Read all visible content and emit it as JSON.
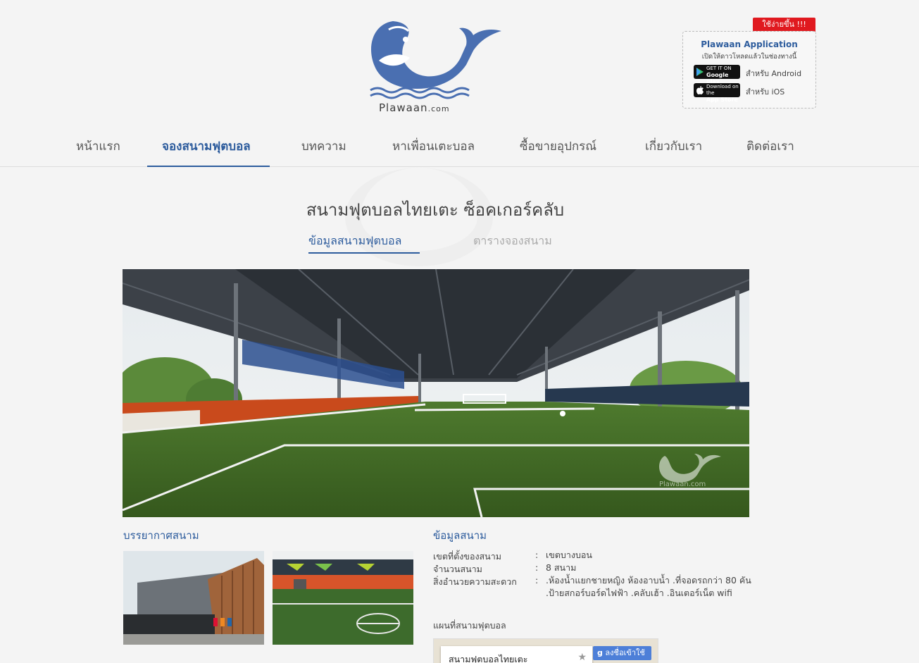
{
  "brand": {
    "logo_text": "Plawaan",
    "logo_domain": ".com",
    "color_primary": "#2d5c9d",
    "color_logo": "#4a6fb1"
  },
  "app_promo": {
    "ribbon": "ใช้ง่ายขึ้น !!!",
    "title": "Plawaan Application",
    "subtitle": "เปิดให้ดาวโหลดแล้วในช่องทางนี้",
    "stores": [
      {
        "badge_small": "GET IT ON",
        "badge_big": "Google play",
        "label": "สำหรับ Android",
        "icon": "google-play-icon"
      },
      {
        "badge_small": "Download on the",
        "badge_big": "App Store",
        "label": "สำหรับ iOS",
        "icon": "apple-icon"
      }
    ]
  },
  "nav": {
    "items": [
      {
        "label": "หน้าแรก"
      },
      {
        "label": "จองสนามฟุตบอล"
      },
      {
        "label": "บทความ"
      },
      {
        "label": "หาเพื่อนเตะบอล"
      },
      {
        "label": "ซื้อขายอุปกรณ์"
      },
      {
        "label": "เกี่ยวกับเรา"
      },
      {
        "label": "ติดต่อเรา"
      }
    ],
    "active_index": 1
  },
  "page": {
    "title": "สนามฟุตบอลไทยเตะ ซ็อคเกอร์คลับ",
    "tabs": [
      {
        "label": "ข้อมูลสนามฟุตบอล",
        "active": true
      },
      {
        "label": "ตารางจองสนาม",
        "active": false
      }
    ],
    "hero_watermark": "Plawaan.com"
  },
  "atmosphere": {
    "title": "บรรยากาศสนาม"
  },
  "field_info": {
    "title": "ข้อมูลสนาม",
    "rows": [
      {
        "label": "เขตที่ตั้งของสนาม",
        "value": "เขตบางบอน"
      },
      {
        "label": "จำนวนสนาม",
        "value": "8 สนาม"
      },
      {
        "label": "สิ่งอำนวยความสะดวก",
        "value": ".ห้องน้ำแยกชายหญิง ห้องอาบน้ำ .ที่จอดรถกว่า 80 คัน .ป้ายสกอร์บอร์ดไฟฟ้า .คลับเฮ้า .อินเตอร์เน็ต wifi"
      }
    ],
    "map_title": "แผนที่สนามฟุตบอล"
  },
  "map": {
    "place_name": "สนามฟุตบอลไทยเตะ",
    "signin": "ลงชื่อเข้าใช้"
  }
}
